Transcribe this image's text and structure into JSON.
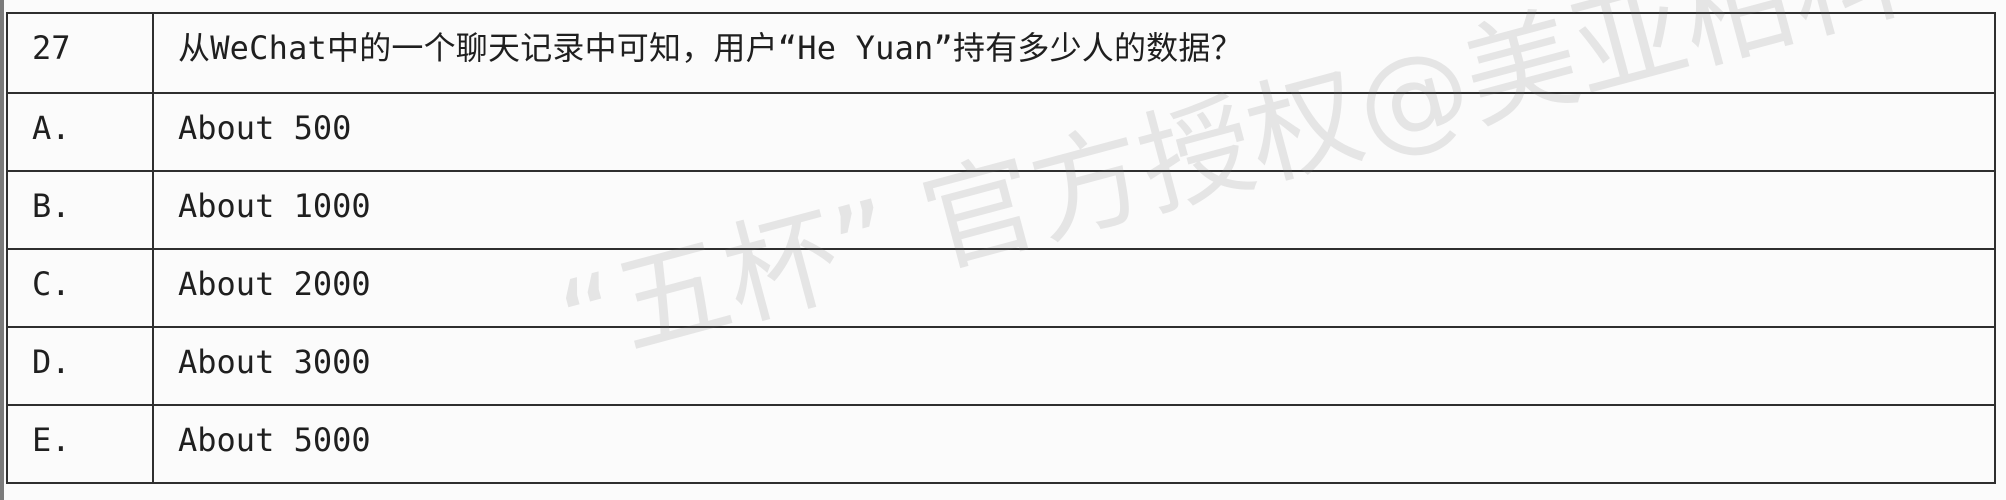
{
  "question": {
    "number": "27",
    "text": "从WeChat中的一个聊天记录中可知，用户“He Yuan”持有多少人的数据？"
  },
  "options": [
    {
      "letter": "A.",
      "text": "About 500"
    },
    {
      "letter": "B.",
      "text": "About 1000"
    },
    {
      "letter": "C.",
      "text": "About 2000"
    },
    {
      "letter": "D.",
      "text": "About 3000"
    },
    {
      "letter": "E.",
      "text": "About 5000"
    }
  ],
  "watermark": {
    "text": "“五杯” 官方授权@美亚柏科"
  }
}
